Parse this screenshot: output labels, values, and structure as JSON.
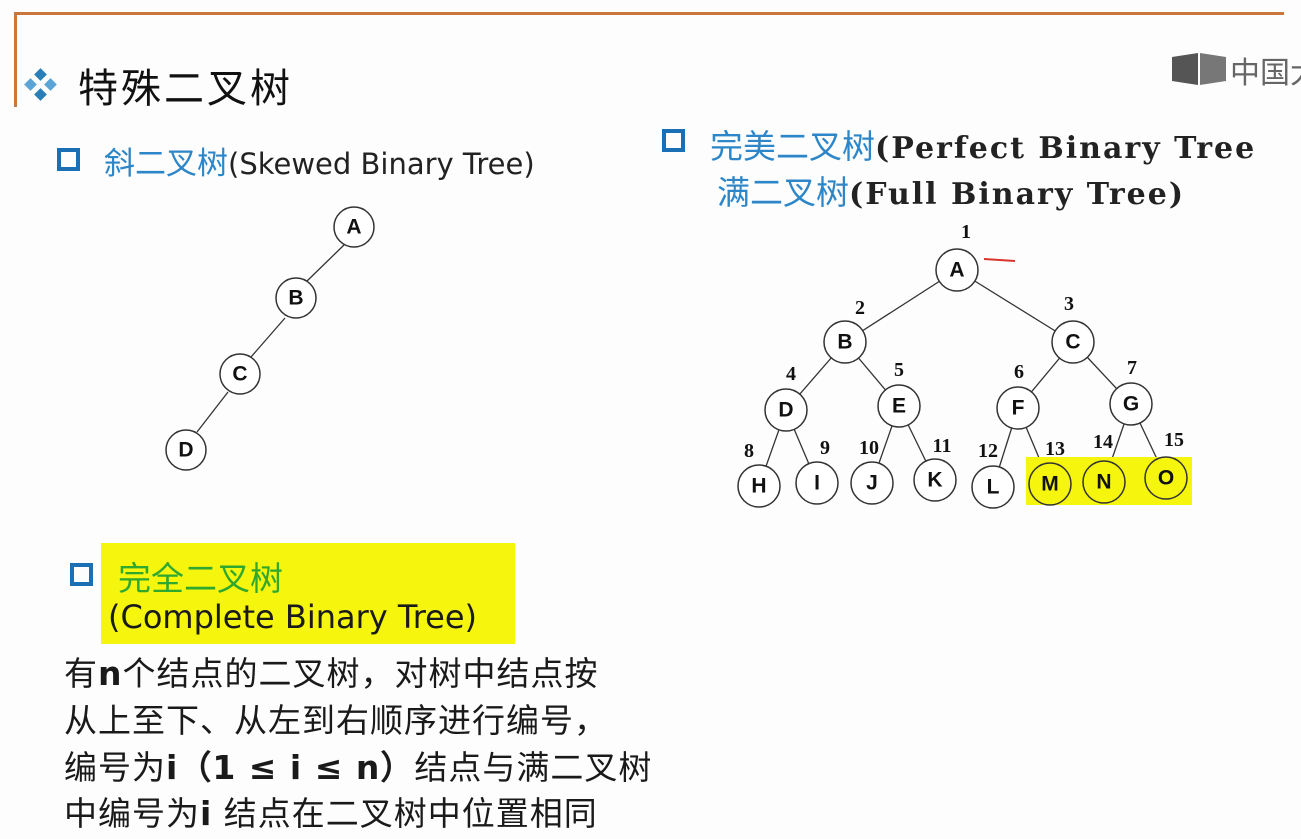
{
  "slide": {
    "title": "特殊二叉树",
    "logo_text": "中国大"
  },
  "skewed": {
    "heading_cn": "斜二叉树",
    "heading_en": "(Skewed Binary Tree)",
    "nodes": [
      "A",
      "B",
      "C",
      "D"
    ]
  },
  "perfect": {
    "heading_cn": "完美二叉树",
    "heading_en": "(Perfect Binary Tree",
    "alt_cn": "满二叉树",
    "alt_en": "(Full Binary Tree)",
    "nodes": [
      {
        "label": "A",
        "num": "1"
      },
      {
        "label": "B",
        "num": "2"
      },
      {
        "label": "C",
        "num": "3"
      },
      {
        "label": "D",
        "num": "4"
      },
      {
        "label": "E",
        "num": "5"
      },
      {
        "label": "F",
        "num": "6"
      },
      {
        "label": "G",
        "num": "7"
      },
      {
        "label": "H",
        "num": "8"
      },
      {
        "label": "I",
        "num": "9"
      },
      {
        "label": "J",
        "num": "10"
      },
      {
        "label": "K",
        "num": "11"
      },
      {
        "label": "L",
        "num": "12"
      },
      {
        "label": "M",
        "num": "13",
        "highlight": true
      },
      {
        "label": "N",
        "num": "14",
        "highlight": true
      },
      {
        "label": "O",
        "num": "15",
        "highlight": true
      }
    ],
    "highlight_color": "#f5f50e"
  },
  "complete": {
    "heading_cn": "完全二叉树",
    "heading_en": "(Complete Binary Tree)",
    "desc1_a": "有",
    "desc1_n": "n",
    "desc1_b": "个结点的二叉树，对树中结点按",
    "desc2": "从上至下、从左到右顺序进行编号，",
    "desc3_a": "编号为",
    "desc3_i": "i",
    "desc3_paren": "（1 ≤ i ≤ n）",
    "desc3_b": "结点与满二叉树",
    "desc4_a": "中编号为",
    "desc4_i": "i",
    "desc4_b": " 结点在二叉树中位置相同"
  },
  "colors": {
    "accent_rule": "#c9773a",
    "heading_blue": "#2d86c8",
    "bullet_blue": "#1a6fb5",
    "complete_green": "#2ea82e",
    "highlight_yellow": "#f5f50e"
  }
}
